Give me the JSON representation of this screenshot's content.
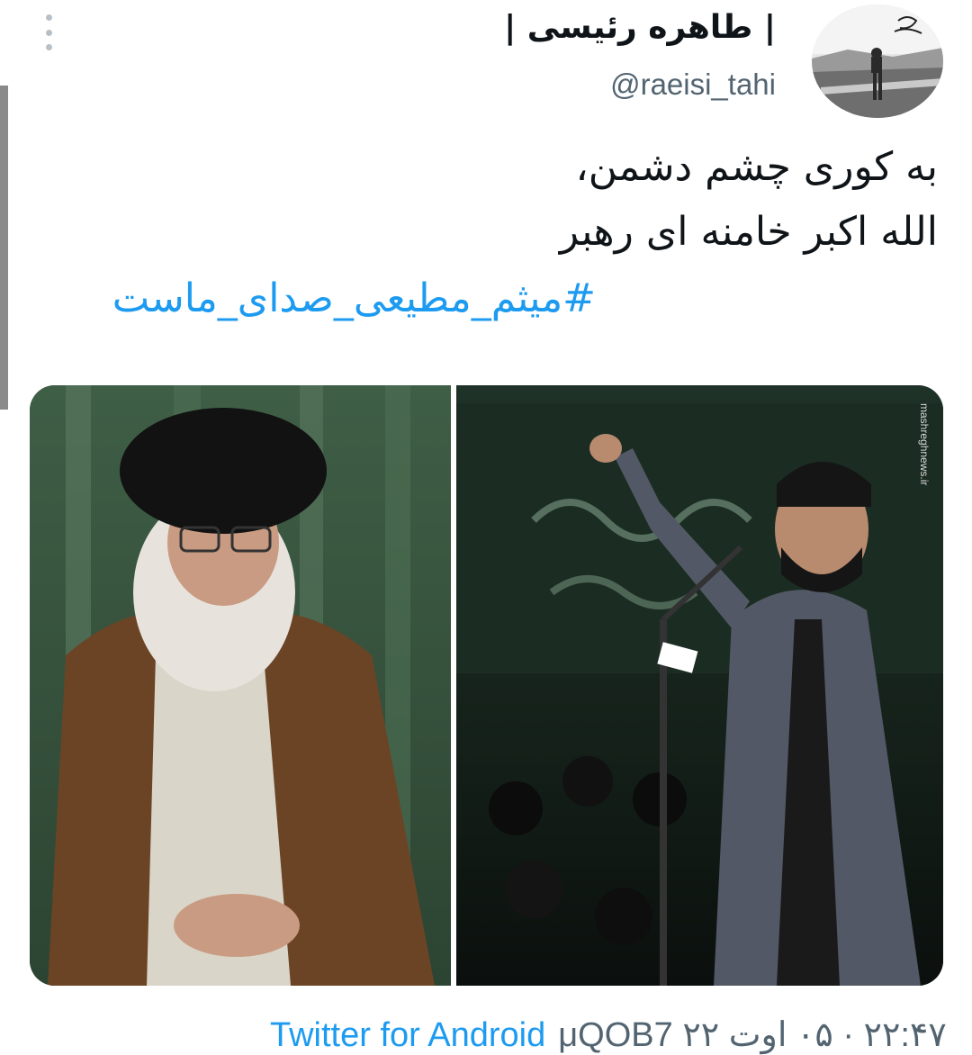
{
  "tweet": {
    "display_name": "| طاهره رئیسی |",
    "handle": "@raeisi_tahi",
    "lines": [
      "به کوری چشم دشمن،",
      "الله اکبر خامنه ای رهبر"
    ],
    "hashtag": "#میثم_مطیعی_صدای_ماست",
    "media_watermark": "mashreghnews.ir",
    "source": "Twitter for Android",
    "datetime": "۲۲:۴۷ · ۰۵ اوت ۲۲ μQOB7"
  },
  "colors": {
    "link": "#1d9bf0",
    "secondary_text": "#536471",
    "primary_text": "#0f1419"
  },
  "icons": {
    "more": "more-vertical-icon"
  }
}
